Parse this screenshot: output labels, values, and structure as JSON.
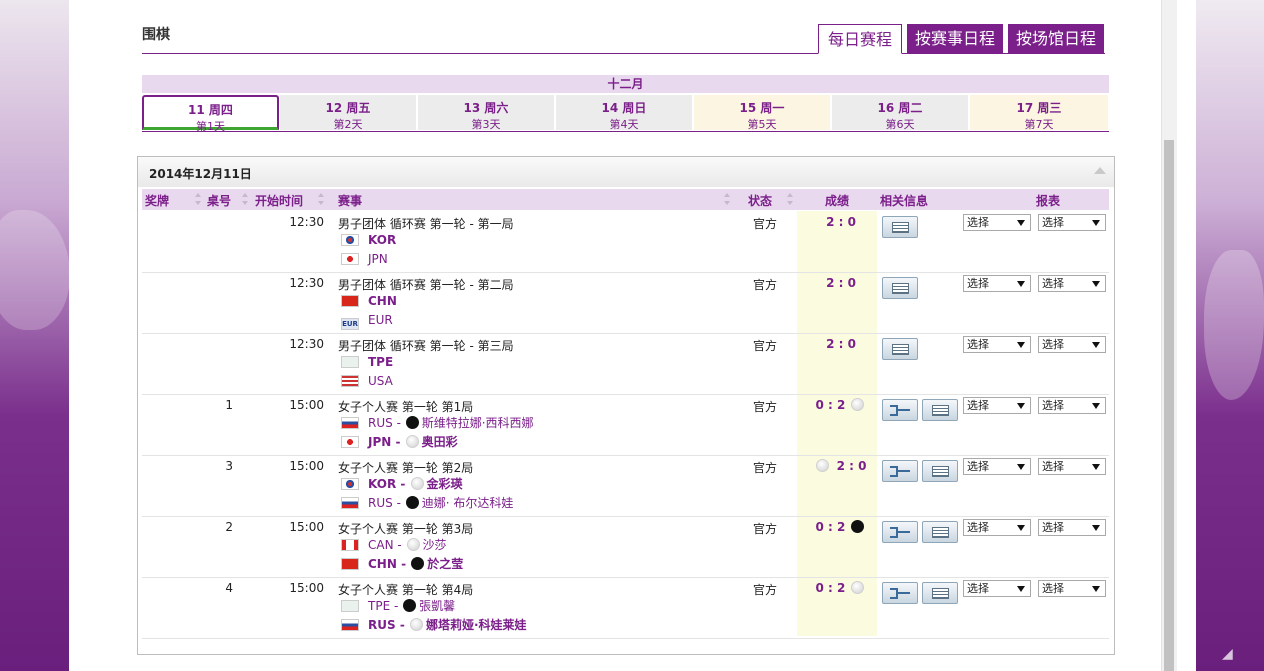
{
  "sport_title": "围棋",
  "tabs": {
    "daily": "每日赛程",
    "by_event": "按赛事日程",
    "by_venue": "按场馆日程"
  },
  "month": "十二月",
  "days": [
    {
      "date": "11 周四",
      "day": "第1天"
    },
    {
      "date": "12 周五",
      "day": "第2天"
    },
    {
      "date": "13 周六",
      "day": "第3天"
    },
    {
      "date": "14 周日",
      "day": "第4天"
    },
    {
      "date": "15 周一",
      "day": "第5天"
    },
    {
      "date": "16 周二",
      "day": "第6天"
    },
    {
      "date": "17 周三",
      "day": "第7天"
    }
  ],
  "panel_date": "2014年12月11日",
  "headers": {
    "medal": "奖牌",
    "table": "桌号",
    "start_time": "开始时间",
    "event": "赛事",
    "status": "状态",
    "result": "成绩",
    "info": "相关信息",
    "report": "报表"
  },
  "select_label": "选择",
  "rows": [
    {
      "table": "",
      "time": "12:30",
      "event": "男子团体 循环赛 第一轮 - 第一局",
      "status": "官方",
      "score": "2 : 0",
      "team1": {
        "code": "KOR",
        "player": ""
      },
      "team2": {
        "code": "JPN",
        "player": ""
      }
    },
    {
      "table": "",
      "time": "12:30",
      "event": "男子团体 循环赛 第一轮 - 第二局",
      "status": "官方",
      "score": "2 : 0",
      "team1": {
        "code": "CHN",
        "player": ""
      },
      "team2": {
        "code": "EUR",
        "player": ""
      }
    },
    {
      "table": "",
      "time": "12:30",
      "event": "男子团体 循环赛 第一轮 - 第三局",
      "status": "官方",
      "score": "2 : 0",
      "team1": {
        "code": "TPE",
        "player": ""
      },
      "team2": {
        "code": "USA",
        "player": ""
      }
    },
    {
      "table": "1",
      "time": "15:00",
      "event": "女子个人赛 第一轮 第1局",
      "status": "官方",
      "score": "0 : 2",
      "team1": {
        "code": "RUS",
        "player": "斯维特拉娜·西科西娜"
      },
      "team2": {
        "code": "JPN",
        "player": "奥田彩"
      }
    },
    {
      "table": "3",
      "time": "15:00",
      "event": "女子个人赛 第一轮 第2局",
      "status": "官方",
      "score": "2 : 0",
      "team1": {
        "code": "KOR",
        "player": "金彩瑛"
      },
      "team2": {
        "code": "RUS",
        "player": "迪娜· 布尔达科娃"
      }
    },
    {
      "table": "2",
      "time": "15:00",
      "event": "女子个人赛 第一轮 第3局",
      "status": "官方",
      "score": "0 : 2",
      "team1": {
        "code": "CAN",
        "player": "沙莎"
      },
      "team2": {
        "code": "CHN",
        "player": "於之莹"
      }
    },
    {
      "table": "4",
      "time": "15:00",
      "event": "女子个人赛 第一轮 第4局",
      "status": "官方",
      "score": "0 : 2",
      "team1": {
        "code": "TPE",
        "player": "張凱馨"
      },
      "team2": {
        "code": "RUS",
        "player": "娜塔莉娅·科娃莱娃"
      }
    }
  ]
}
